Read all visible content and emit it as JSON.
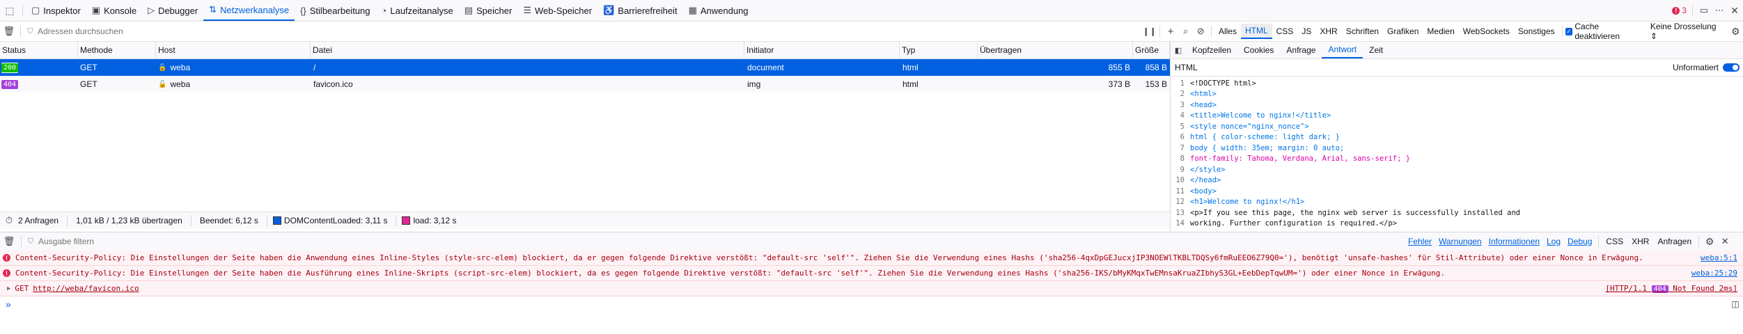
{
  "toolbar": {
    "tabs": [
      {
        "label": "Inspektor",
        "icon": "inspector-icon"
      },
      {
        "label": "Konsole",
        "icon": "console-icon"
      },
      {
        "label": "Debugger",
        "icon": "debugger-icon"
      },
      {
        "label": "Netzwerkanalyse",
        "icon": "network-icon",
        "selected": true
      },
      {
        "label": "Stilbearbeitung",
        "icon": "style-editor-icon"
      },
      {
        "label": "Laufzeitanalyse",
        "icon": "performance-icon"
      },
      {
        "label": "Speicher",
        "icon": "memory-icon"
      },
      {
        "label": "Web-Speicher",
        "icon": "storage-icon"
      },
      {
        "label": "Barrierefreiheit",
        "icon": "accessibility-icon"
      },
      {
        "label": "Anwendung",
        "icon": "application-icon"
      }
    ],
    "error_count": "3"
  },
  "network": {
    "filter_placeholder": "Adressen durchsuchen",
    "type_filters": [
      "Alles",
      "HTML",
      "CSS",
      "JS",
      "XHR",
      "Schriften",
      "Grafiken",
      "Medien",
      "WebSockets",
      "Sonstiges"
    ],
    "selected_filter": "HTML",
    "cache_label": "Cache deaktivieren",
    "throttle_label": "Keine Drosselung ⇕",
    "columns": [
      "Status",
      "Methode",
      "Host",
      "Datei",
      "Initiator",
      "Typ",
      "Übertragen",
      "Größe"
    ],
    "requests": [
      {
        "status": "200",
        "method": "GET",
        "host": "weba",
        "file": "/",
        "initiator": "document",
        "type": "html",
        "transferred": "855 B",
        "size": "858 B"
      },
      {
        "status": "404",
        "method": "GET",
        "host": "weba",
        "file": "favicon.ico",
        "initiator": "img",
        "type": "html",
        "transferred": "373 B",
        "size": "153 B"
      }
    ],
    "summary": {
      "requests": "2 Anfragen",
      "transfer": "1,01 kB / 1,23 kB übertragen",
      "finished": "Beendet: 6,12 s",
      "dom_loaded": "DOMContentLoaded: 3,11 s",
      "load": "load: 3,12 s"
    }
  },
  "sidepanel": {
    "tabs": [
      "Kopfzeilen",
      "Cookies",
      "Anfrage",
      "Antwort",
      "Zeit"
    ],
    "selected_tab": "Antwort",
    "format_label": "HTML",
    "raw_label": "Unformatiert",
    "code_lines": [
      "<!DOCTYPE html>",
      "<html>",
      "<head>",
      "<title>Welcome to nginx!</title>",
      "<style nonce=\"nginx_nonce\">",
      "html { color-scheme: light dark; }",
      "body { width: 35em; margin: 0 auto;",
      "font-family: Tahoma, Verdana, Arial, sans-serif; }",
      "</style>",
      "</head>",
      "<body>",
      "<h1>Welcome to nginx!</h1>",
      "<p>If you see this page, the nginx web server is successfully installed and",
      "working. Further configuration is required.</p>"
    ]
  },
  "console": {
    "filter_placeholder": "Ausgabe filtern",
    "levels": [
      "Fehler",
      "Warnungen",
      "Informationen",
      "Log",
      "Debug"
    ],
    "extra": [
      "CSS",
      "XHR",
      "Anfragen"
    ],
    "messages": [
      {
        "text": "Content-Security-Policy: Die Einstellungen der Seite haben die Anwendung eines Inline-Styles (style-src-elem) blockiert, da er gegen folgende Direktive verstößt: \"default-src 'self'\". Ziehen Sie die Verwendung eines Hashs ('sha256-4qxDpGEJucxjIP3NOEWlTKBLTDQSy6fmRuEEO6Z79Q0='), benötigt 'unsafe-hashes' für Stil-Attribute) oder einer Nonce in Erwägung.",
        "location": "weba:5:1"
      },
      {
        "text": "Content-Security-Policy: Die Einstellungen der Seite haben die Ausführung eines Inline-Skripts (script-src-elem) blockiert, da es gegen folgende Direktive verstößt: \"default-src 'self'\". Ziehen Sie die Verwendung eines Hashs ('sha256-IKS/bMyKMqxTwEMnsaKruaZIbhyS3GL+EebDepTqwUM=') oder einer Nonce in Erwägung.",
        "location": "weba:25:29"
      },
      {
        "method": "GET",
        "url": "http://weba/favicon.ico",
        "http": "[HTTP/1.1 ",
        "code": "404",
        "status_text": " Not Found 2ms]"
      }
    ],
    "prompt": "»"
  }
}
